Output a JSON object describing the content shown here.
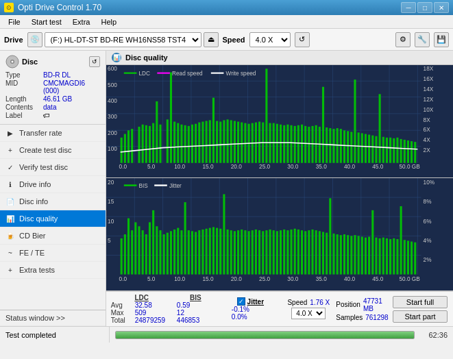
{
  "app": {
    "title": "Opti Drive Control 1.70",
    "icon": "⊙"
  },
  "titlebar": {
    "minimize": "─",
    "maximize": "□",
    "close": "✕"
  },
  "menu": {
    "items": [
      "File",
      "Start test",
      "Extra",
      "Help"
    ]
  },
  "drive_toolbar": {
    "drive_label": "Drive",
    "drive_value": "(F:)  HL-DT-ST BD-RE  WH16NS58 TST4",
    "speed_label": "Speed",
    "speed_value": "4.0 X"
  },
  "disc": {
    "title": "Disc",
    "type_label": "Type",
    "type_value": "BD-R DL",
    "mid_label": "MID",
    "mid_value": "CMCMAGDI6 (000)",
    "length_label": "Length",
    "length_value": "46.61 GB",
    "contents_label": "Contents",
    "contents_value": "data",
    "label_label": "Label"
  },
  "nav": {
    "items": [
      {
        "id": "transfer-rate",
        "label": "Transfer rate",
        "icon": "▶"
      },
      {
        "id": "create-test-disc",
        "label": "Create test disc",
        "icon": "💿"
      },
      {
        "id": "verify-test-disc",
        "label": "Verify test disc",
        "icon": "✓"
      },
      {
        "id": "drive-info",
        "label": "Drive info",
        "icon": "ℹ"
      },
      {
        "id": "disc-info",
        "label": "Disc info",
        "icon": "📄"
      },
      {
        "id": "disc-quality",
        "label": "Disc quality",
        "icon": "📊",
        "active": true
      },
      {
        "id": "cd-bier",
        "label": "CD Bier",
        "icon": "🍺"
      },
      {
        "id": "fe-te",
        "label": "FE / TE",
        "icon": "~"
      },
      {
        "id": "extra-tests",
        "label": "Extra tests",
        "icon": "+"
      }
    ]
  },
  "status_window": {
    "label": "Status window >>"
  },
  "disc_quality": {
    "title": "Disc quality",
    "legend": {
      "ldc_label": "LDC",
      "read_speed_label": "Read speed",
      "write_speed_label": "Write speed",
      "bis_label": "BIS",
      "jitter_label": "Jitter"
    },
    "chart1": {
      "y_max": 600,
      "y_right_labels": [
        "18X",
        "16X",
        "14X",
        "12X",
        "10X",
        "8X",
        "6X",
        "4X",
        "2X"
      ],
      "x_labels": [
        "0.0",
        "5.0",
        "10.0",
        "15.0",
        "20.0",
        "25.0",
        "30.0",
        "35.0",
        "40.0",
        "45.0",
        "50.0 GB"
      ]
    },
    "chart2": {
      "y_max": 20,
      "y_right_labels": [
        "10%",
        "8%",
        "6%",
        "4%",
        "2%"
      ],
      "x_labels": [
        "0.0",
        "5.0",
        "10.0",
        "15.0",
        "20.0",
        "25.0",
        "30.0",
        "35.0",
        "40.0",
        "45.0",
        "50.0 GB"
      ]
    }
  },
  "stats": {
    "ldc_header": "LDC",
    "bis_header": "BIS",
    "jitter_label": "Jitter",
    "speed_label": "Speed",
    "position_label": "Position",
    "samples_label": "Samples",
    "avg_label": "Avg",
    "max_label": "Max",
    "total_label": "Total",
    "ldc_avg": "32.58",
    "ldc_max": "509",
    "ldc_total": "24879259",
    "bis_avg": "0.59",
    "bis_max": "12",
    "bis_total": "446853",
    "jitter_avg": "-0.1%",
    "jitter_max": "0.0%",
    "speed_val": "1.76 X",
    "speed_dropdown": "4.0 X",
    "position_val": "47731 MB",
    "samples_val": "761298",
    "start_full": "Start full",
    "start_part": "Start part"
  },
  "statusbar": {
    "status_text": "Test completed",
    "progress": 100,
    "time": "62:36"
  },
  "colors": {
    "ldc": "#00ff00",
    "read_speed": "#ffffff",
    "write_speed": "#ff00ff",
    "bis": "#00ff00",
    "jitter": "#ffffff",
    "chart_bg": "#1a2a4a",
    "grid": "#2a4a7a",
    "accent": "#0078d7"
  }
}
